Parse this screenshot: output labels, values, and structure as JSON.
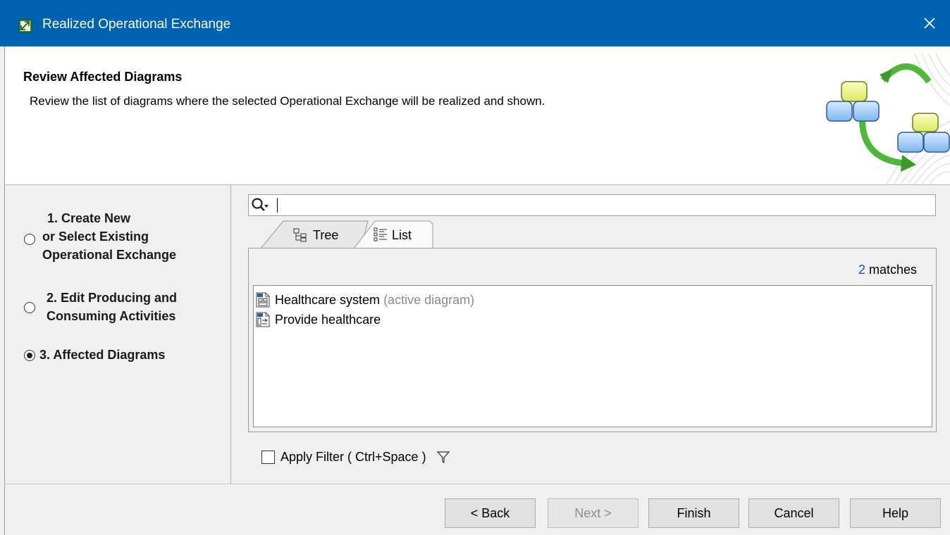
{
  "window": {
    "title": "Realized Operational Exchange"
  },
  "header": {
    "title": "Review Affected Diagrams",
    "description": "Review the list of diagrams where the selected Operational Exchange will be realized and shown."
  },
  "steps": [
    {
      "lines": [
        "1. Create New",
        "or Select Existing",
        "Operational Exchange"
      ],
      "selected": false
    },
    {
      "lines": [
        "2. Edit Producing and",
        "Consuming Activities"
      ],
      "selected": false
    },
    {
      "lines": [
        "3. Affected Diagrams"
      ],
      "selected": true
    }
  ],
  "search": {
    "value": ""
  },
  "tabs": [
    {
      "label": "Tree",
      "icon": "tree-icon",
      "active": false
    },
    {
      "label": "List",
      "icon": "list-icon",
      "active": true
    }
  ],
  "results": {
    "count": "2",
    "count_suffix": " matches",
    "items": [
      {
        "name": "Healthcare system",
        "note": "(active diagram)",
        "icon": "diagram-icon"
      },
      {
        "name": "Provide healthcare",
        "note": "",
        "icon": "activity-diagram-icon"
      }
    ]
  },
  "filter": {
    "label": "Apply Filter ( Ctrl+Space )",
    "checked": false
  },
  "buttons": {
    "back": "< Back",
    "next": "Next >",
    "finish": "Finish",
    "cancel": "Cancel",
    "help": "Help"
  },
  "colors": {
    "titlebar": "#0063b1",
    "accent_count": "#1a4fd6"
  }
}
